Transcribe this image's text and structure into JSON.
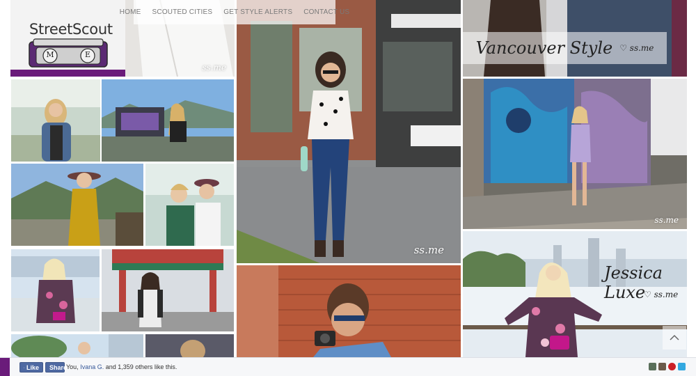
{
  "nav": {
    "items": [
      "HOME",
      "SCOUTED CITIES",
      "GET STYLE ALERTS",
      "CONTACT US"
    ]
  },
  "logo": {
    "text": "StreetScout",
    "letters": [
      "M",
      "E"
    ]
  },
  "watermark": "ss.me",
  "features": {
    "vancouver": {
      "title": "Vancouver Style",
      "handle": "ss.me"
    },
    "jessica": {
      "title": "Jessica Luxe",
      "handle": "ss.me"
    }
  },
  "facebook": {
    "like_label": "Like",
    "share_label": "Share",
    "you": "You,",
    "friend": "Ivana G.",
    "rest": "and 1,359 others like this."
  },
  "social_icons": [
    "google-plus-icon",
    "instagram-icon",
    "pinterest-icon",
    "twitter-icon"
  ],
  "colors": {
    "brand_purple": "#6a1b7a",
    "facebook_blue": "#4e69a2",
    "nav_text": "#7a7a7a"
  }
}
